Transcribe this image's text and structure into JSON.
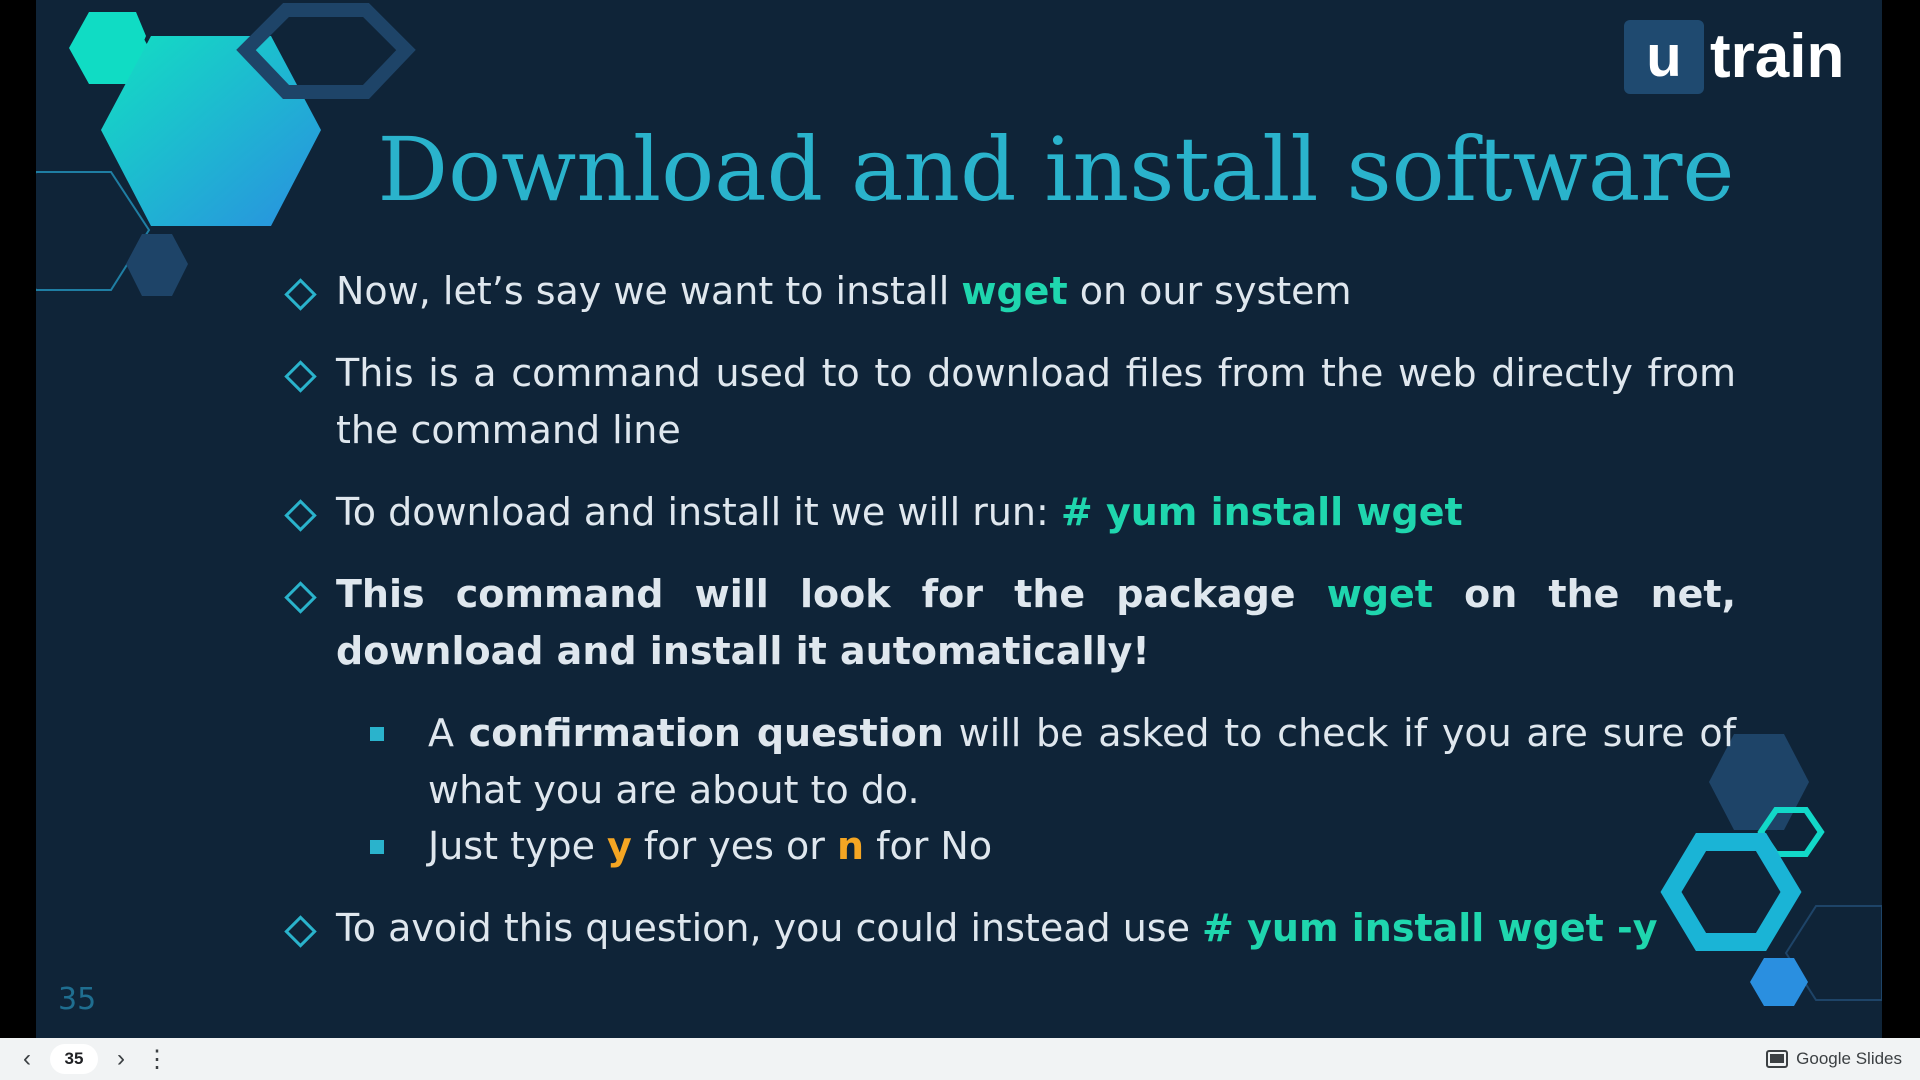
{
  "slide": {
    "logo": {
      "mark": "u",
      "text": "train"
    },
    "title": "Download and install software",
    "bullets": [
      {
        "t1": "Now, let’s say we want to install ",
        "t2": "wget",
        "t3": " on our system"
      },
      {
        "t1": "This is a command used to to download files from the web directly from the command line"
      },
      {
        "t1": "To download and  install it we will run: ",
        "t2": "# yum install wget"
      },
      {
        "t1": "This command will look for the package ",
        "t2": "wget",
        "t3": " on the net, download and install it automatically!"
      },
      {
        "t1": "To avoid this question, you could instead use ",
        "t2": "# yum install wget -y"
      }
    ],
    "subbullets": [
      {
        "t1": "A ",
        "t2": "confirmation question",
        "t3": " will be asked to check if you are sure of what you are about to do."
      },
      {
        "t1": "Just type ",
        "t2": "y",
        "t3": " for yes or ",
        "t4": "n",
        "t5": " for No"
      }
    ],
    "number": "35"
  },
  "toolbar": {
    "prev_icon": "chevron-left-icon",
    "prev_glyph": "‹",
    "page": "35",
    "next_icon": "chevron-right-icon",
    "next_glyph": "›",
    "more_icon": "more-vert-icon",
    "more_glyph": "⋮",
    "brand_icon": "slides-icon",
    "brand": "Google Slides"
  },
  "colors": {
    "background": "#0f2438",
    "title": "#2ab3cc",
    "highlight": "#1fd6ae",
    "yes_no": "#f5a623",
    "body_text": "#dfe7ee"
  }
}
